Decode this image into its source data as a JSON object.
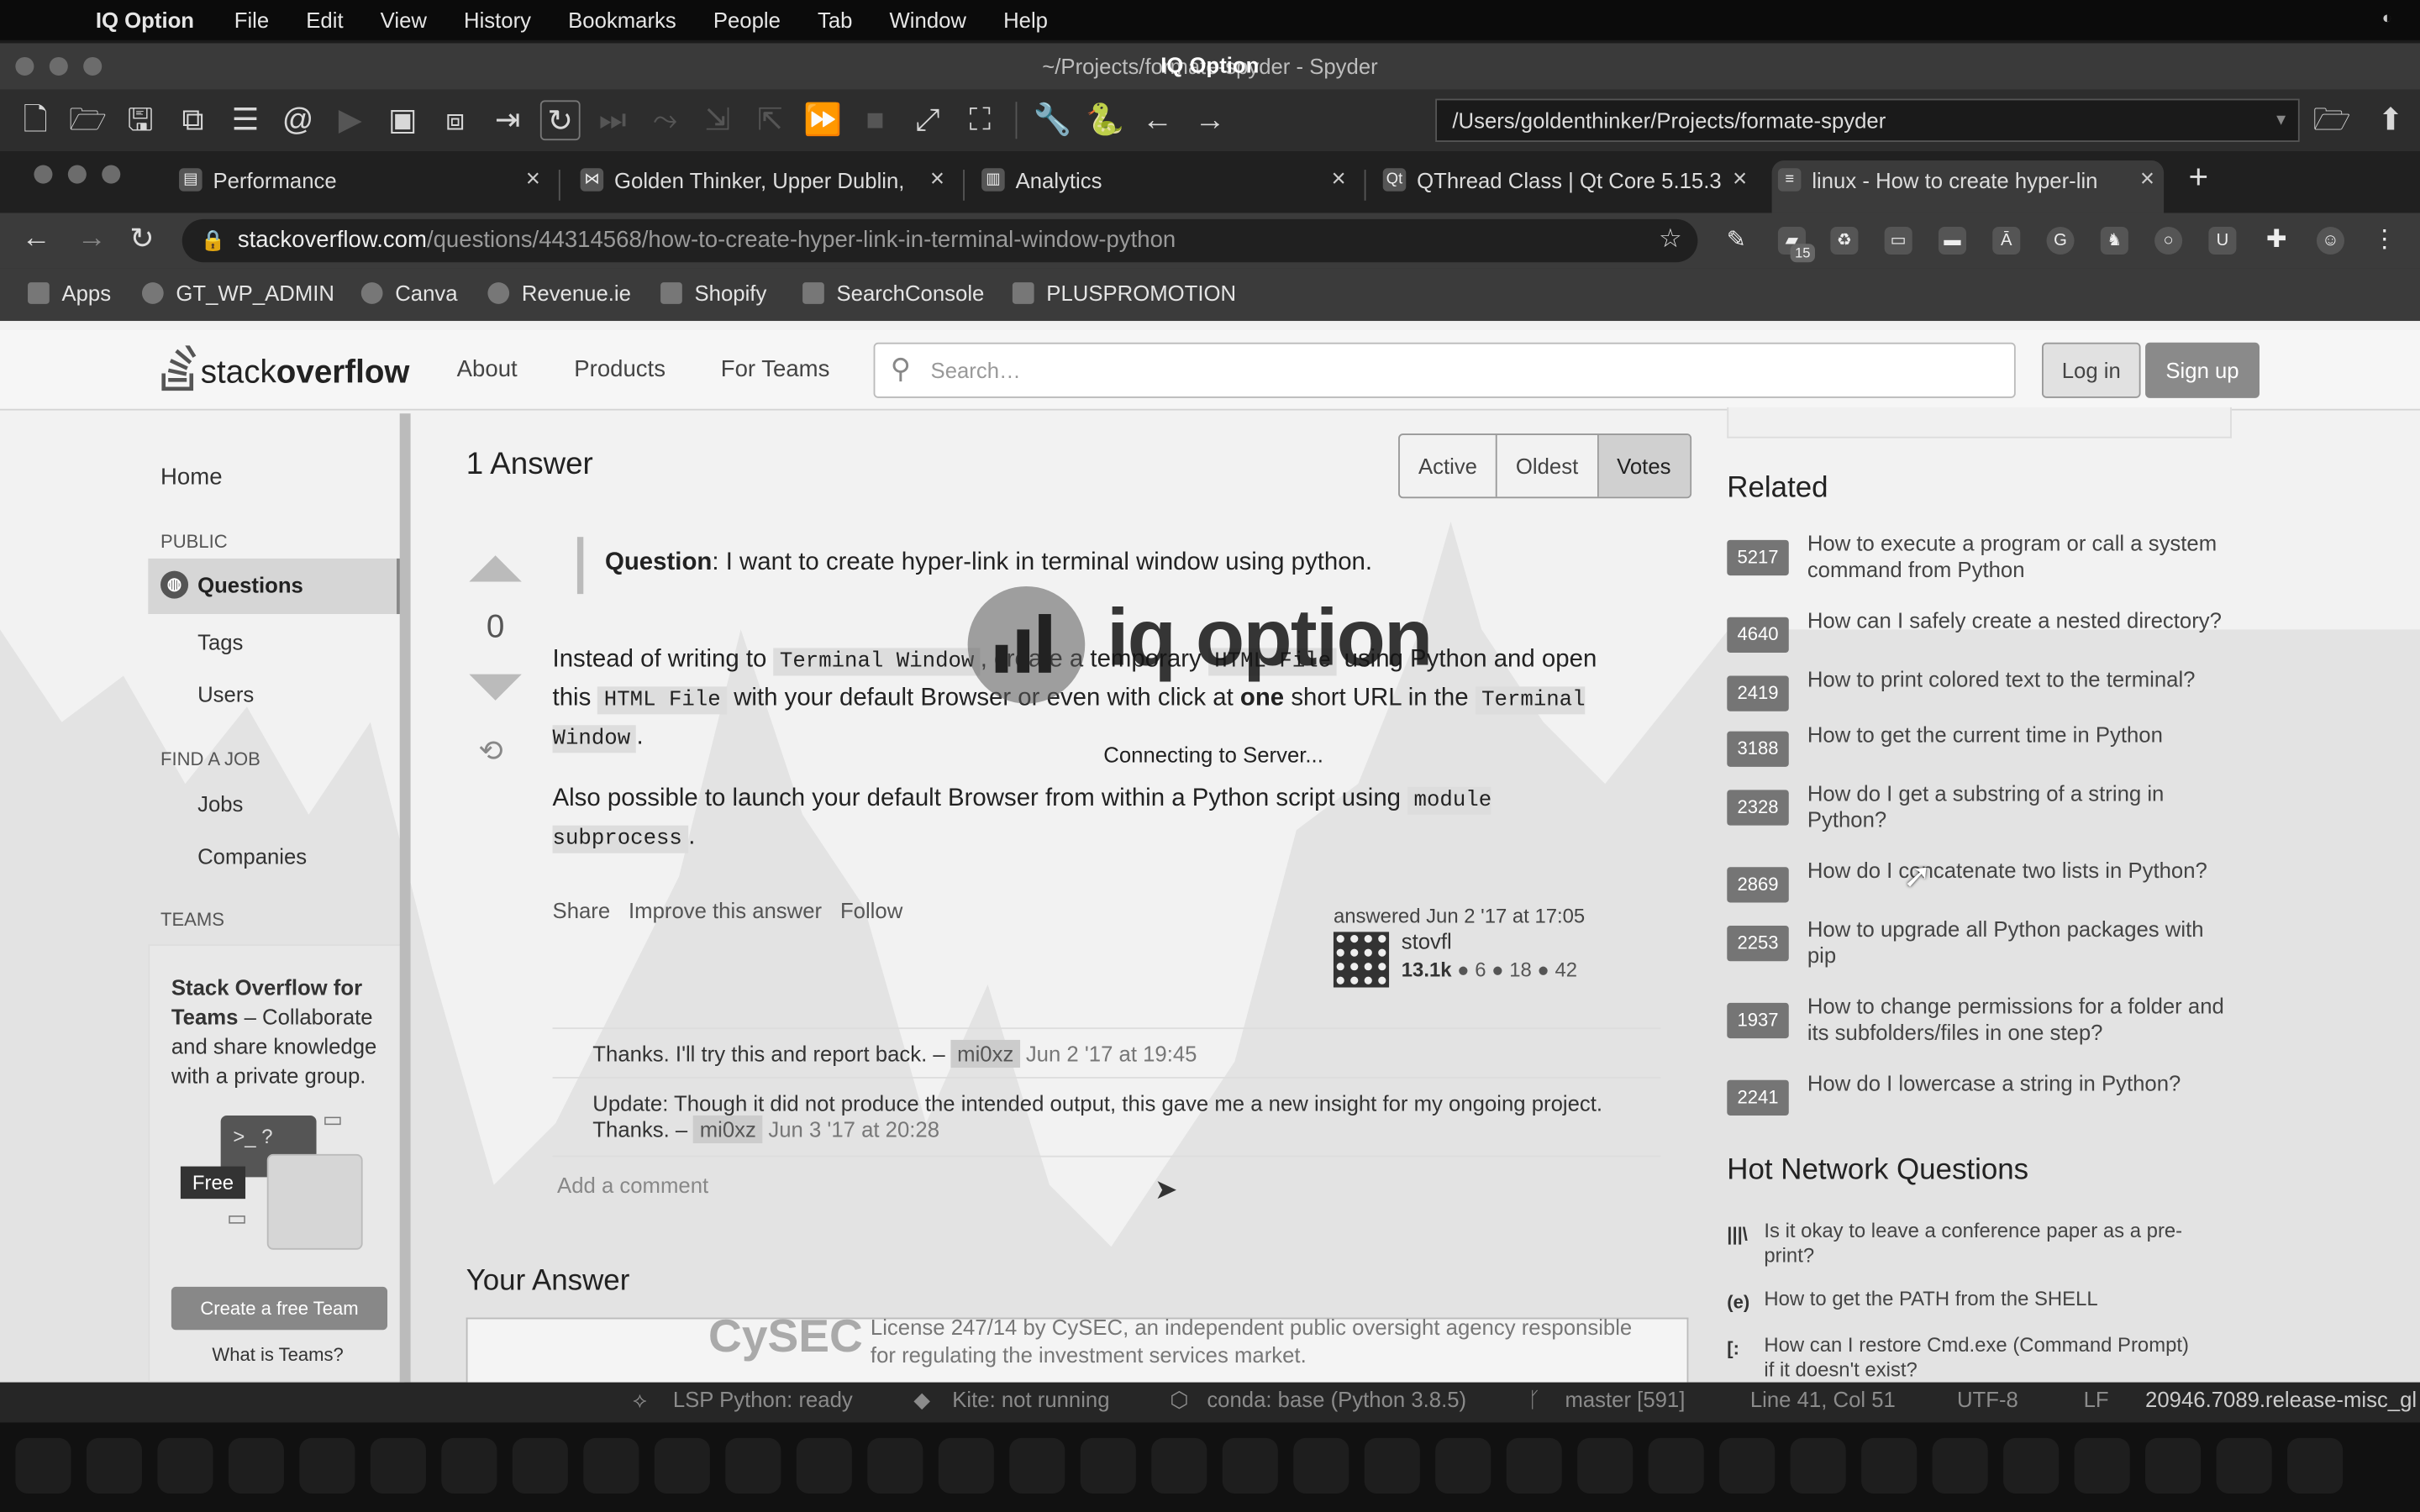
{
  "menubar": {
    "app": "IQ Option",
    "items": [
      "File",
      "Edit",
      "View",
      "History",
      "Bookmarks",
      "People",
      "Tab",
      "Window",
      "Help"
    ]
  },
  "spyder": {
    "title": "~/Projects/formate-spyder - Spyder",
    "overlay_title": "IQ Option",
    "path": "/Users/goldenthinker/Projects/formate-spyder"
  },
  "tabs": [
    {
      "title": "Performance",
      "icon": "performance-icon"
    },
    {
      "title": "Golden Thinker, Upper Dublin,",
      "icon": "location-icon"
    },
    {
      "title": "Analytics",
      "icon": "analytics-icon"
    },
    {
      "title": "QThread Class | Qt Core 5.15.3",
      "icon": "qt-icon"
    },
    {
      "title": "linux - How to create hyper-lin",
      "icon": "stackoverflow-icon"
    }
  ],
  "omnibox": {
    "host": "stackoverflow.com",
    "path": "/questions/44314568/how-to-create-hyper-link-in-terminal-window-python"
  },
  "extension_badge": "15",
  "bookmarks": [
    "Apps",
    "GT_WP_ADMIN",
    "Canva",
    "Revenue.ie",
    "Shopify",
    "SearchConsole",
    "PLUSPROMOTION"
  ],
  "so": {
    "logo_light": "stack",
    "logo_bold": "overflow",
    "nav": [
      "About",
      "Products",
      "For Teams"
    ],
    "search_placeholder": "Search…",
    "login": "Log in",
    "signup": "Sign up",
    "leftnav": {
      "home": "Home",
      "public": "PUBLIC",
      "questions": "Questions",
      "tags": "Tags",
      "users": "Users",
      "find_job": "FIND A JOB",
      "jobs": "Jobs",
      "companies": "Companies",
      "teams": "TEAMS"
    },
    "teams": {
      "title": "Stack Overflow for Teams",
      "text": " – Collaborate and share knowledge with a private group.",
      "terminal": ">_ ?",
      "free": "Free",
      "create": "Create a free Team",
      "what": "What is Teams?"
    }
  },
  "answer": {
    "count": "1 Answer",
    "sort": [
      "Active",
      "Oldest",
      "Votes"
    ],
    "votes": "0",
    "quote_label": "Question",
    "quote_text": ": I want to create hyper-link in terminal window using python.",
    "p1": {
      "a": "Instead of writing to ",
      "c1": "Terminal Window",
      ", create a temporary ": "",
      "b": ", create a temporary ",
      "c2": "HTML File",
      "d": " using Python and open this ",
      "c3": "HTML File",
      "e": " with your default Browser or even with click at ",
      "f": "one",
      "g": " short URL in the ",
      "c4": "Terminal Window",
      "h": "."
    },
    "p2": {
      "a": "Also possible to launch your default Browser from within a Python script using ",
      "c1": "module subprocess",
      "b": "."
    },
    "menu": [
      "Share",
      "Improve this answer",
      "Follow"
    ],
    "answered": "answered Jun 2 '17 at 17:05",
    "user": "stovfl",
    "rep": "13.1k",
    "badges": [
      "6",
      "18",
      "42"
    ],
    "comments": [
      {
        "text": "Thanks. I'll try this and report back. – ",
        "user": "mi0xz",
        "date": "Jun 2 '17 at 19:45"
      },
      {
        "text": "Update: Though it did not produce the intended output, this gave me a new insight for my ongoing project. Thanks. – ",
        "user": "mi0xz",
        "date": "Jun 3 '17 at 20:28"
      }
    ],
    "add_comment": "Add a comment",
    "your_answer": "Your Answer"
  },
  "related": {
    "title": "Related",
    "items": [
      {
        "count": "5217",
        "q": "How to execute a program or call a system command from Python"
      },
      {
        "count": "4640",
        "q": "How can I safely create a nested directory?"
      },
      {
        "count": "2419",
        "q": "How to print colored text to the terminal?"
      },
      {
        "count": "3188",
        "q": "How to get the current time in Python"
      },
      {
        "count": "2328",
        "q": "How do I get a substring of a string in Python?"
      },
      {
        "count": "2869",
        "q": "How do I concatenate two lists in Python?"
      },
      {
        "count": "2253",
        "q": "How to upgrade all Python packages with pip"
      },
      {
        "count": "1937",
        "q": "How to change permissions for a folder and its subfolders/files in one step?"
      },
      {
        "count": "2241",
        "q": "How do I lowercase a string in Python?"
      }
    ]
  },
  "hnq": {
    "title": "Hot Network Questions",
    "items": [
      {
        "site": "academia-icon",
        "q": "Is it okay to leave a conference paper as a pre-print?"
      },
      {
        "site": "unix-icon",
        "q": "How to get the PATH from the SHELL"
      },
      {
        "site": "superuser-icon",
        "q": "How can I restore Cmd.exe (Command Prompt) if it doesn't exist?"
      }
    ]
  },
  "iq": {
    "brand": "iq option",
    "connecting": "Connecting to Server...",
    "cysec": "CySEC",
    "license": "License 247/14 by CySEC, an independent public oversight agency responsible for regulating the investment services market."
  },
  "status": {
    "lsp": "LSP Python: ready",
    "kite": "Kite: not running",
    "conda": "conda: base (Python 3.8.5)",
    "git": "master [591]",
    "pos": "Line 41, Col 51",
    "enc": "UTF-8",
    "eol": "LF",
    "extra": "20946.7089.release-misc_gl"
  }
}
